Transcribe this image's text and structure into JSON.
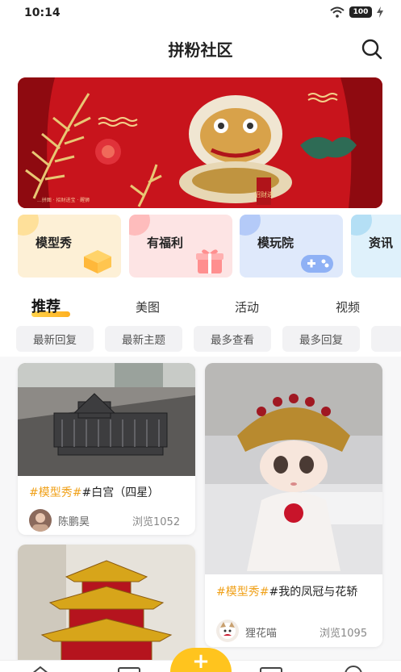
{
  "status": {
    "time": "10:14",
    "battery": "100"
  },
  "header": {
    "title": "拼粉社区"
  },
  "banner": {
    "caption": "...拼图 · 招财进宝 · 醒狮",
    "stamp": "招财进"
  },
  "categories": [
    {
      "label": "模型秀",
      "color": "#fdf0d6",
      "accent": "#ffd36a",
      "icon": "box-icon"
    },
    {
      "label": "有福利",
      "color": "#fde4e4",
      "accent": "#ff9a9a",
      "icon": "gift-icon"
    },
    {
      "label": "模玩院",
      "color": "#dfe9fb",
      "accent": "#8fb1f5",
      "icon": "gamepad-icon"
    },
    {
      "label": "资讯",
      "color": "#dff1fb",
      "accent": "#8fd0f0",
      "icon": "news-icon"
    }
  ],
  "tabs": [
    "推荐",
    "美图",
    "活动",
    "视频"
  ],
  "filters": [
    "最新回复",
    "最新主题",
    "最多查看",
    "最多回复"
  ],
  "posts": [
    {
      "tag": "#模型秀#",
      "title": "#白宫（四星）",
      "author": "陈鹏昊",
      "views": "浏览1052"
    },
    {
      "tag": "#模型秀#",
      "title": "#我的凤冠与花轿",
      "author": "狸花喵",
      "views": "浏览1095"
    }
  ],
  "colors": {
    "accent": "#ffc41e",
    "tag": "#f0a11a",
    "banner_red": "#c8141c"
  }
}
